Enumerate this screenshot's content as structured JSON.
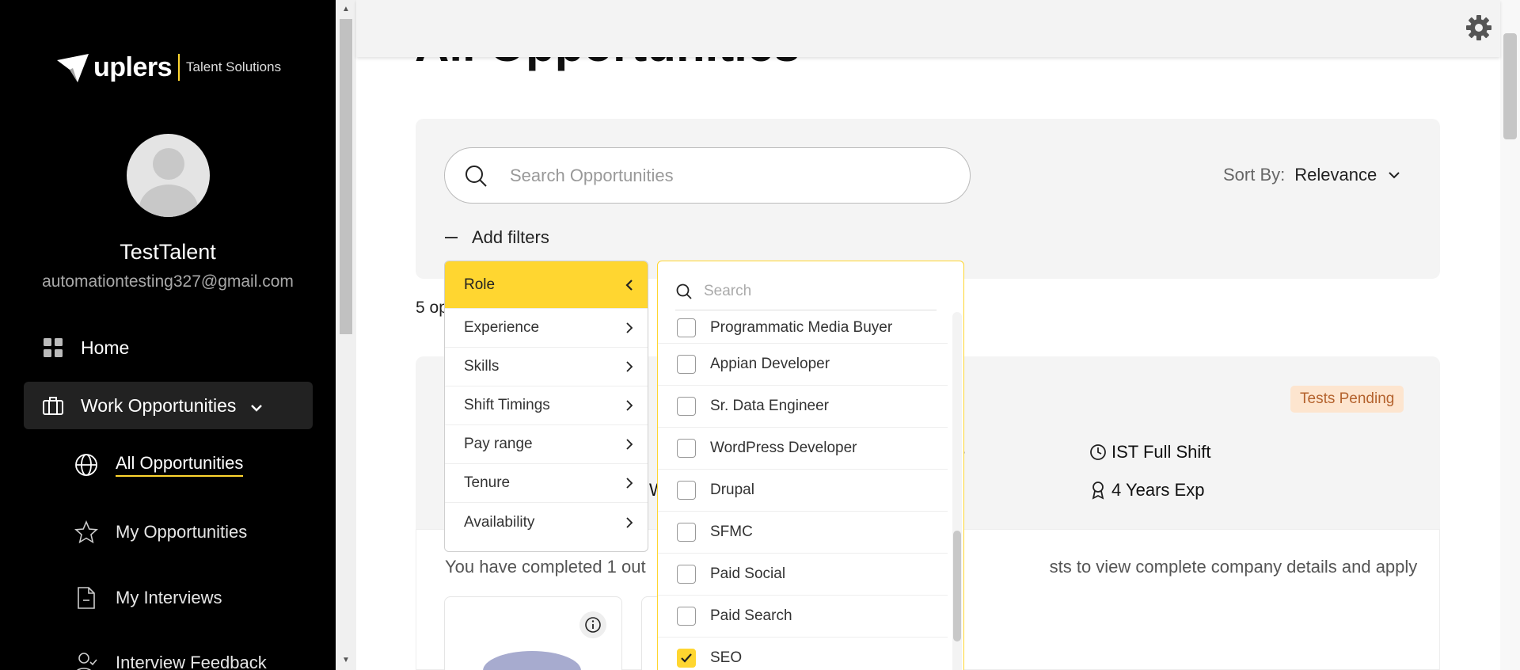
{
  "brand": {
    "name": "uplers",
    "tagline": "Talent Solutions",
    "accent": "#ffd630"
  },
  "user": {
    "name": "TestTalent",
    "email": "automationtesting327@gmail.com"
  },
  "nav": {
    "home": "Home",
    "work": "Work Opportunities",
    "sub": {
      "all": "All Opportunities",
      "mine": "My Opportunities",
      "interviews": "My Interviews",
      "feedback": "Interview Feedback"
    }
  },
  "page": {
    "title": "All Opportunities",
    "count_text": "5 op"
  },
  "search": {
    "placeholder": "Search Opportunities"
  },
  "sort": {
    "label": "Sort By:",
    "value": "Relevance"
  },
  "filters": {
    "toggle_label": "Add filters",
    "categories": [
      "Role",
      "Experience",
      "Skills",
      "Shift Timings",
      "Pay range",
      "Tenure",
      "Availability"
    ],
    "options_search_placeholder": "Search",
    "options": [
      {
        "label": "Programmatic Media Buyer",
        "checked": false
      },
      {
        "label": "Appian Developer",
        "checked": false
      },
      {
        "label": "Sr. Data Engineer",
        "checked": false
      },
      {
        "label": "WordPress Developer",
        "checked": false
      },
      {
        "label": "Drupal",
        "checked": false
      },
      {
        "label": "SFMC",
        "checked": false
      },
      {
        "label": "Paid Social",
        "checked": false
      },
      {
        "label": "Paid Search",
        "checked": false
      },
      {
        "label": "SEO",
        "checked": true
      }
    ]
  },
  "opportunity": {
    "badge": "Tests Pending",
    "shift": "IST Full Shift",
    "experience": "4 Years Exp",
    "fragment_e": "e",
    "fragment_w": "W",
    "completed_start": "You have completed 1 out",
    "completed_end": "sts to view complete company details and apply"
  }
}
